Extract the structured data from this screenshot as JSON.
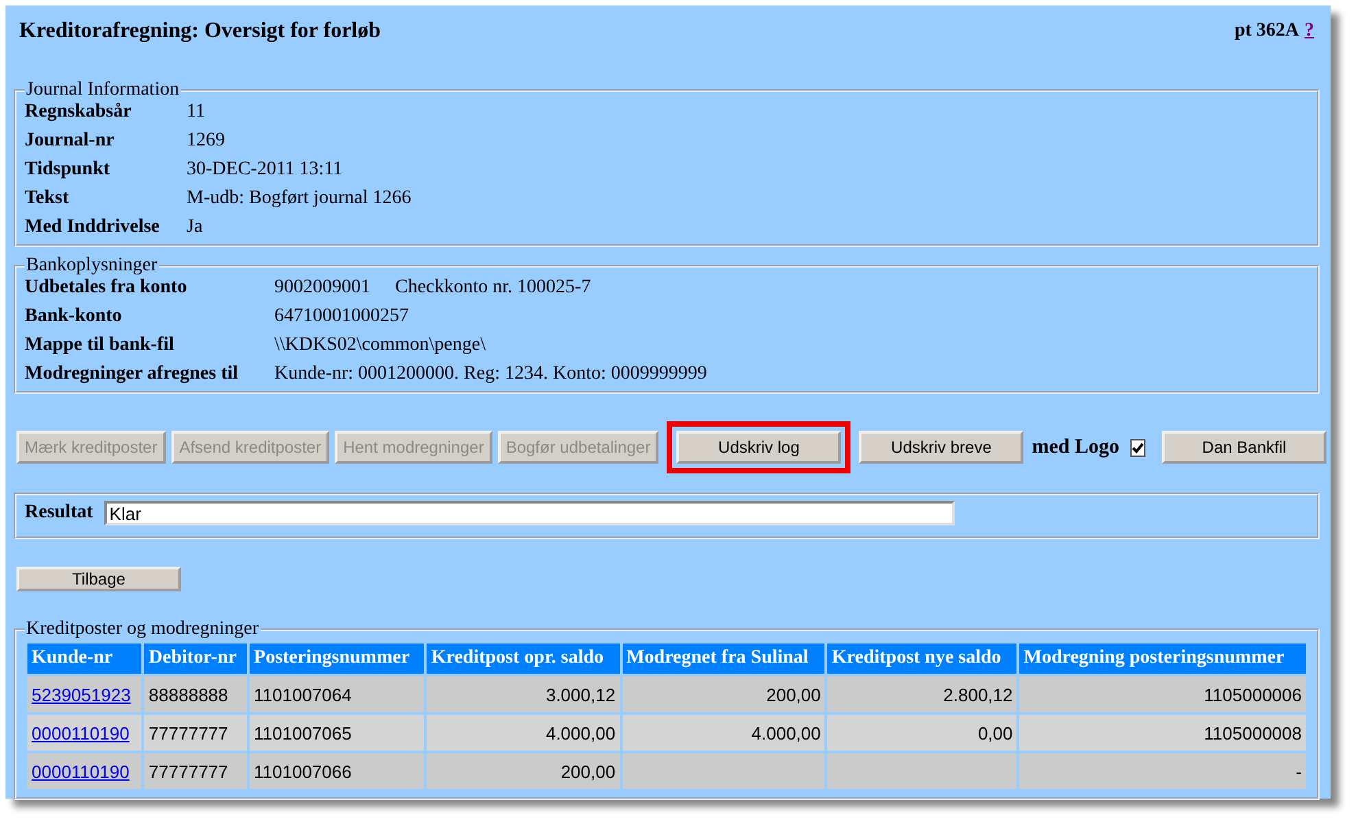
{
  "header": {
    "title": "Kreditorafregning: Oversigt for forløb",
    "code": "pt 362A",
    "help_link": "?"
  },
  "journal_information": {
    "legend": "Journal Information",
    "fields": [
      {
        "label": "Regnskabsår",
        "value": "11"
      },
      {
        "label": "Journal-nr",
        "value": "1269"
      },
      {
        "label": "Tidspunkt",
        "value": "30-DEC-2011 13:11"
      },
      {
        "label": "Tekst",
        "value": "M-udb: Bogført journal 1266"
      },
      {
        "label": "Med Inddrivelse",
        "value": "Ja"
      }
    ]
  },
  "bankoplysninger": {
    "legend": "Bankoplysninger",
    "fields": [
      {
        "label": "Udbetales fra konto",
        "value": "9002009001",
        "extra": "Checkkonto nr. 100025-7"
      },
      {
        "label": "Bank-konto",
        "value": "64710001000257"
      },
      {
        "label": "Mappe til bank-fil",
        "value": "\\\\KDKS02\\common\\penge\\"
      },
      {
        "label": "Modregninger afregnes til",
        "value": "Kunde-nr: 0001200000. Reg: 1234. Konto: 0009999999"
      }
    ]
  },
  "actions": [
    {
      "label": "Mærk kreditposter",
      "disabled": true,
      "highlighted": false
    },
    {
      "label": "Afsend kreditposter",
      "disabled": true,
      "highlighted": false
    },
    {
      "label": "Hent modregninger",
      "disabled": true,
      "highlighted": false
    },
    {
      "label": "Bogfør udbetalinger",
      "disabled": true,
      "highlighted": false
    },
    {
      "label": "Udskriv log",
      "disabled": false,
      "highlighted": true
    },
    {
      "label": "Udskriv breve",
      "disabled": false,
      "highlighted": false
    }
  ],
  "med_logo": {
    "label": "med Logo",
    "checked": true
  },
  "bankfil_button": {
    "label": "Dan Bankfil",
    "disabled": false
  },
  "resultat": {
    "label": "Resultat",
    "value": "Klar"
  },
  "back_button": {
    "label": "Tilbage"
  },
  "table": {
    "legend": "Kreditposter og modregninger",
    "columns": [
      "Kunde-nr",
      "Debitor-nr",
      "Posteringsnummer",
      "Kreditpost opr. saldo",
      "Modregnet fra Sulinal",
      "Kreditpost nye saldo",
      "Modregning posteringsnummer"
    ],
    "rows": [
      [
        "5239051923",
        "88888888",
        "1101007064",
        "3.000,12",
        "200,00",
        "2.800,12",
        "1105000006"
      ],
      [
        "0000110190",
        "77777777",
        "1101007065",
        "4.000,00",
        "4.000,00",
        "0,00",
        "1105000008"
      ],
      [
        "0000110190",
        "77777777",
        "1101007066",
        "200,00",
        "",
        "",
        "-"
      ]
    ]
  }
}
